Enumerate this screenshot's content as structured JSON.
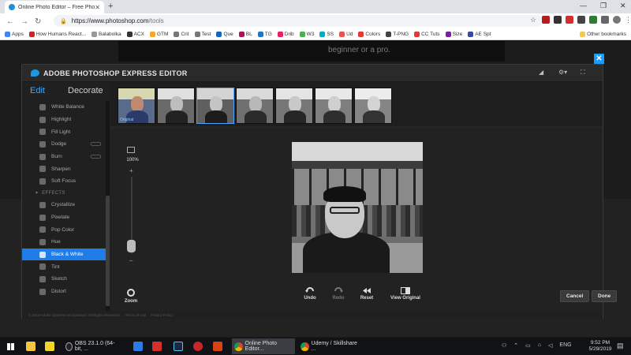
{
  "browser": {
    "tab_title": "Online Photo Editor – Free Photo...",
    "url_host": "https://www.photoshop.com",
    "url_path": "/tools",
    "bookmarks": [
      "Apps",
      "How Humans React...",
      "Balabolka",
      "ACX",
      "GTM",
      "Crit",
      "Test",
      "Que",
      "BL",
      "TG",
      "Drib",
      "W3",
      "SS",
      "Ud",
      "Colors",
      "T-PNG",
      "CC Tuts",
      "Size",
      "AE Spt"
    ],
    "other_bookmarks": "Other bookmarks"
  },
  "page": {
    "hero_text": "beginner or a pro."
  },
  "editor": {
    "title": "ADOBE PHOTOSHOP EXPRESS EDITOR",
    "tab_edit": "Edit",
    "tab_decorate": "Decorate",
    "tools_top": [
      "White Balance",
      "Highlight",
      "Fill Light",
      "Dodge",
      "Burn",
      "Sharpen",
      "Soft Focus"
    ],
    "effects_header": "EFFECTS",
    "effects": [
      "Crystallize",
      "Pixelate",
      "Pop Color",
      "Hue",
      "Black & White",
      "Tint",
      "Sketch",
      "Distort"
    ],
    "selected_effect": "Black & White",
    "thumb_label": "Original",
    "zoom_percent": "100%",
    "zoom_level": 0.1,
    "zoom_label": "Zoom",
    "undo": "Undo",
    "redo": "Redo",
    "reset": "Reset",
    "view_original": "View Original",
    "cancel": "Cancel",
    "done": "Done",
    "footer_copyright": "© 2019 Adobe Systems Incorporated. All Rights Reserved.",
    "footer_terms": "Terms of Use",
    "footer_privacy": "Privacy Policy"
  },
  "taskbar": {
    "tasks": [
      "OBS 23.1.0 (64-bit, ...",
      "Online Photo Editor...",
      "Udemy / Skillshare ..."
    ],
    "lang": "ENG",
    "time": "9:52 PM",
    "date": "5/29/2019"
  },
  "colors": {
    "accent": "#1f7de8",
    "adobe_blue": "#1d97e0"
  }
}
